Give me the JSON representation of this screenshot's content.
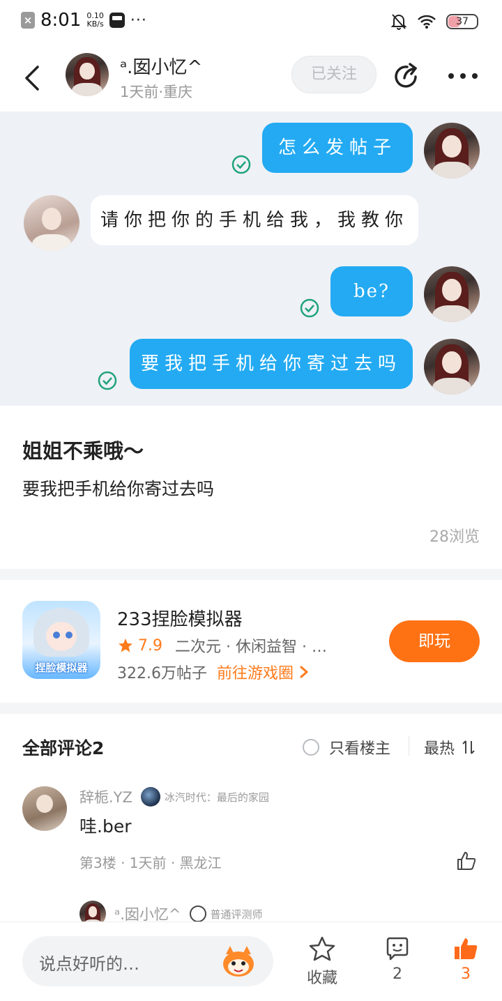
{
  "status_bar": {
    "time": "8:01",
    "speed_value": "0.10",
    "speed_unit": "KB/s",
    "battery": "37"
  },
  "header": {
    "name": "ᵃ.囡小忆^",
    "subtitle": "1天前·重庆",
    "follow_label": "已关注"
  },
  "chat": {
    "messages": [
      {
        "side": "me",
        "text": "怎么发帖子"
      },
      {
        "side": "them",
        "text": "请你把你的手机给我，我教你"
      },
      {
        "side": "me",
        "text": "be?"
      },
      {
        "side": "me",
        "text": "要我把手机给你寄过去吗"
      }
    ]
  },
  "post": {
    "title": "姐姐不乘哦～",
    "body": "要我把手机给你寄过去吗",
    "views": "28浏览"
  },
  "game": {
    "icon_text": "捏脸模拟器",
    "name": "233捏脸模拟器",
    "rating": "7.9",
    "tags": "二次元 · 休闲益智 · …",
    "posts": "322.6万帖子",
    "goto_label": "前往游戏圈",
    "play_label": "即玩",
    "accent_color": "#ff7214"
  },
  "comments": {
    "title": "全部评论2",
    "only_host_label": "只看楼主",
    "sort_label": "最热",
    "items": [
      {
        "user": "辞栀.YZ",
        "badge": "冰汽时代：最后的家园",
        "text": "哇.ber",
        "meta": "第3楼 · 1天前 · 黑龙江"
      }
    ],
    "reply": {
      "user": "ᵃ.囡小忆^",
      "badge": "普通评测师"
    }
  },
  "bottom_bar": {
    "input_placeholder": "说点好听的…",
    "favorite_label": "收藏",
    "comment_count": "2",
    "like_count": "3"
  }
}
